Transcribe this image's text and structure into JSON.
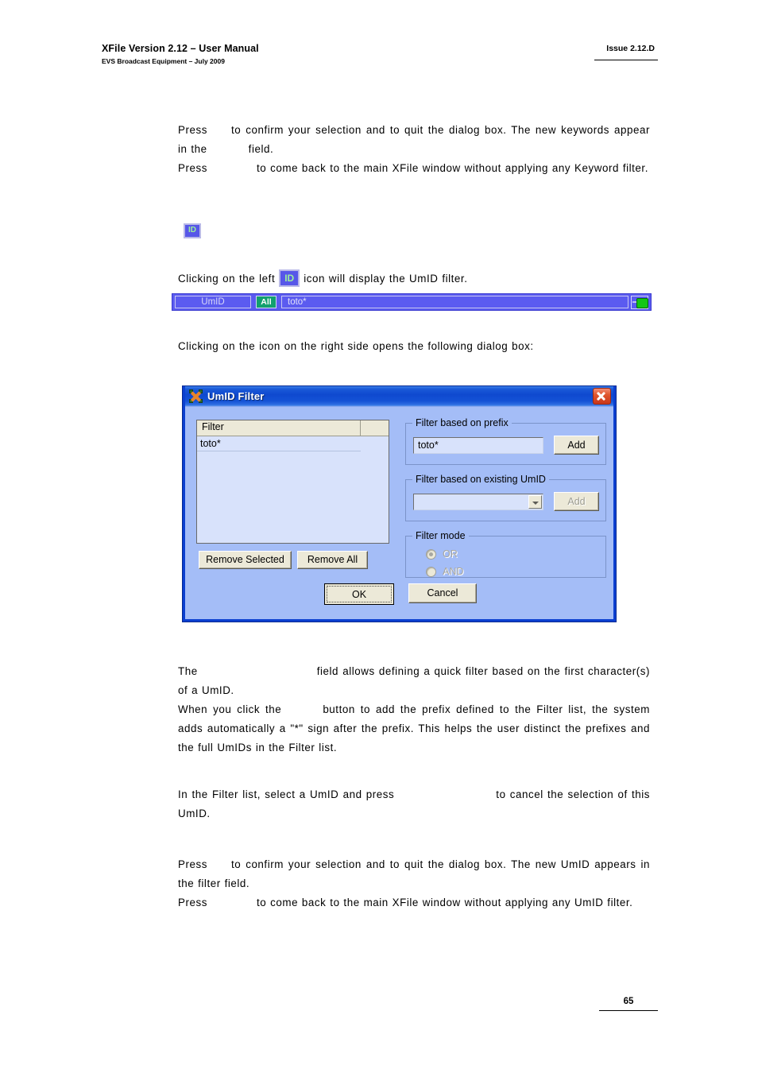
{
  "header": {
    "title": "XFile Version 2.12 – User Manual",
    "subtitle": "EVS Broadcast Equipment – July 2009",
    "issue": "Issue 2.12.D"
  },
  "paragraphs": {
    "p1_a": "Press",
    "p1_b": "to confirm your selection and to quit the dialog box. The new keywords appear in the",
    "p1_c": "field.",
    "p2_a": "Press",
    "p2_b": "to come back to the main XFile window without applying any Keyword filter.",
    "p3_a": "Clicking on the left",
    "p3_b": "icon will display the UmID filter.",
    "p4": "Clicking on the icon on the right side opens the following dialog box:",
    "p5_a": "The",
    "p5_b": "field allows defining a quick filter based on the first character(s) of a UmID.",
    "p6_a": "When you click the",
    "p6_b": "button to add the prefix defined to the Filter list, the system adds automatically a \"*\" sign after the prefix. This helps the user distinct the prefixes and the full UmIDs in the Filter list.",
    "p7_a": "In the Filter list, select a UmID and press",
    "p7_b": "to cancel the selection of this UmID.",
    "p8_a": "Press",
    "p8_b": "to confirm your selection and to quit the dialog box. The new UmID appears in the filter field.",
    "p9_a": "Press",
    "p9_b": "to come back to the main XFile window without applying any UmID filter."
  },
  "id_icon": {
    "label": "ID"
  },
  "filter_bar": {
    "label": "UmID",
    "scope": "All",
    "value": "toto*"
  },
  "dialog": {
    "title": "UmID Filter",
    "list": {
      "column_header": "Filter",
      "rows": [
        "toto*"
      ]
    },
    "buttons": {
      "remove_selected": "Remove Selected",
      "remove_all": "Remove All",
      "ok": "OK",
      "cancel": "Cancel"
    },
    "prefix_group": {
      "legend": "Filter based on prefix",
      "input_value": "toto*",
      "add_label": "Add"
    },
    "existing_group": {
      "legend": "Filter based on existing UmID",
      "combo_value": "",
      "add_label": "Add"
    },
    "mode_group": {
      "legend": "Filter mode",
      "options": [
        "OR",
        "AND"
      ],
      "selected": "OR"
    }
  },
  "footer": {
    "page_number": "65"
  },
  "colors": {
    "dialog_frame": "#0a3fd0",
    "dialog_body": "#a4bdf7",
    "filter_bar_bg": "#5b5bf0",
    "all_badge": "#12a06e",
    "button_face": "#ece9d8"
  }
}
